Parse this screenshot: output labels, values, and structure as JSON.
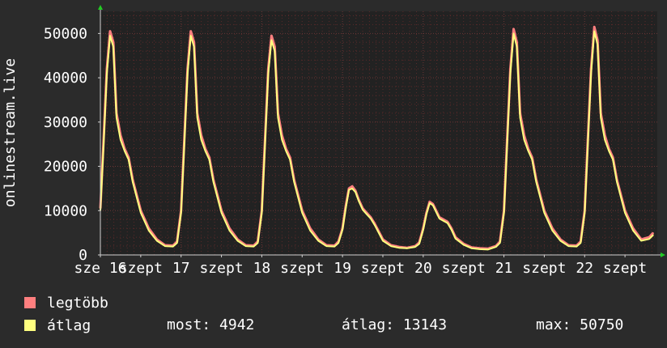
{
  "chart_data": {
    "type": "line",
    "ylabel": "onlinestream.live",
    "xlabel": "",
    "ylim": [
      0,
      55000
    ],
    "yticks": [
      0,
      10000,
      20000,
      30000,
      40000,
      50000
    ],
    "ytick_labels": [
      "0",
      "10000",
      "20000",
      "30000",
      "40000",
      "50000"
    ],
    "x_range_days": [
      16,
      23
    ],
    "x_ticks": [
      {
        "pos": 16,
        "label": "sze 16"
      },
      {
        "pos": 16.5,
        "label": "szept"
      },
      {
        "pos": 17,
        "label": "17"
      },
      {
        "pos": 17.5,
        "label": "szept"
      },
      {
        "pos": 18,
        "label": "18"
      },
      {
        "pos": 18.5,
        "label": "szept"
      },
      {
        "pos": 19,
        "label": "19"
      },
      {
        "pos": 19.5,
        "label": "szept"
      },
      {
        "pos": 20,
        "label": "20"
      },
      {
        "pos": 20.5,
        "label": "szept"
      },
      {
        "pos": 21,
        "label": "21"
      },
      {
        "pos": 21.5,
        "label": "szept"
      },
      {
        "pos": 22,
        "label": "22"
      },
      {
        "pos": 22.5,
        "label": "szept"
      }
    ],
    "grid": true,
    "colors": {
      "background": "#2b2b2b",
      "plot_bg": "#222222",
      "grid_minor": "#5a2a2a",
      "grid_major": "#6a3636",
      "max_series": "#ff7f7f",
      "avg_series": "#ffff7f",
      "axis": "#d0d0d0",
      "arrow": "#22cc22"
    },
    "series": [
      {
        "name": "legtöbb",
        "color": "#ff7f7f",
        "x": [
          16.0,
          16.04,
          16.08,
          16.12,
          16.16,
          16.2,
          16.25,
          16.3,
          16.35,
          16.4,
          16.5,
          16.6,
          16.7,
          16.8,
          16.9,
          16.95,
          17.0,
          17.04,
          17.08,
          17.12,
          17.16,
          17.2,
          17.25,
          17.3,
          17.35,
          17.4,
          17.5,
          17.6,
          17.7,
          17.8,
          17.9,
          17.95,
          18.0,
          18.04,
          18.08,
          18.12,
          18.16,
          18.2,
          18.25,
          18.3,
          18.35,
          18.4,
          18.5,
          18.6,
          18.7,
          18.8,
          18.9,
          18.95,
          19.0,
          19.04,
          19.08,
          19.12,
          19.16,
          19.2,
          19.25,
          19.3,
          19.35,
          19.4,
          19.5,
          19.6,
          19.7,
          19.8,
          19.9,
          19.95,
          20.0,
          20.04,
          20.08,
          20.12,
          20.16,
          20.2,
          20.25,
          20.3,
          20.35,
          20.4,
          20.5,
          20.6,
          20.7,
          20.8,
          20.9,
          20.95,
          21.0,
          21.04,
          21.08,
          21.12,
          21.16,
          21.2,
          21.25,
          21.3,
          21.35,
          21.4,
          21.5,
          21.6,
          21.7,
          21.8,
          21.9,
          21.95,
          22.0,
          22.04,
          22.08,
          22.12,
          22.16,
          22.2,
          22.25,
          22.3,
          22.35,
          22.4,
          22.5,
          22.6,
          22.7,
          22.8,
          22.85
        ],
        "values": [
          10500,
          26000,
          42000,
          50500,
          48000,
          32000,
          27000,
          24000,
          22000,
          17000,
          10000,
          6000,
          3500,
          2200,
          2100,
          3000,
          10000,
          26000,
          42000,
          50500,
          48000,
          32000,
          27000,
          24000,
          22000,
          17000,
          10000,
          6000,
          3500,
          2200,
          2100,
          3000,
          10000,
          26000,
          42000,
          49500,
          47000,
          32000,
          27000,
          24000,
          22000,
          17000,
          10000,
          6000,
          3500,
          2200,
          2100,
          3000,
          6000,
          11000,
          15000,
          15500,
          14500,
          12500,
          10500,
          9500,
          8500,
          7000,
          3500,
          2200,
          1800,
          1600,
          2000,
          2800,
          6000,
          9500,
          12000,
          11500,
          10000,
          8500,
          8000,
          7500,
          6000,
          4000,
          2500,
          1700,
          1500,
          1400,
          2000,
          3000,
          10000,
          26000,
          42000,
          51000,
          48000,
          32000,
          27000,
          24000,
          22000,
          17000,
          10000,
          6000,
          3500,
          2200,
          2100,
          3000,
          10000,
          26000,
          42000,
          51500,
          48500,
          32000,
          27000,
          24000,
          22000,
          17000,
          10000,
          6000,
          3500,
          4000,
          5000
        ]
      },
      {
        "name": "átlag",
        "color": "#ffff7f",
        "x": [
          16.0,
          16.04,
          16.08,
          16.12,
          16.16,
          16.2,
          16.25,
          16.3,
          16.35,
          16.4,
          16.5,
          16.6,
          16.7,
          16.8,
          16.9,
          16.95,
          17.0,
          17.04,
          17.08,
          17.12,
          17.16,
          17.2,
          17.25,
          17.3,
          17.35,
          17.4,
          17.5,
          17.6,
          17.7,
          17.8,
          17.9,
          17.95,
          18.0,
          18.04,
          18.08,
          18.12,
          18.16,
          18.2,
          18.25,
          18.3,
          18.35,
          18.4,
          18.5,
          18.6,
          18.7,
          18.8,
          18.9,
          18.95,
          19.0,
          19.04,
          19.08,
          19.12,
          19.16,
          19.2,
          19.25,
          19.3,
          19.35,
          19.4,
          19.5,
          19.6,
          19.7,
          19.8,
          19.9,
          19.95,
          20.0,
          20.04,
          20.08,
          20.12,
          20.16,
          20.2,
          20.25,
          20.3,
          20.35,
          20.4,
          20.5,
          20.6,
          20.7,
          20.8,
          20.9,
          20.95,
          21.0,
          21.04,
          21.08,
          21.12,
          21.16,
          21.2,
          21.25,
          21.3,
          21.35,
          21.4,
          21.5,
          21.6,
          21.7,
          21.8,
          21.9,
          21.95,
          22.0,
          22.04,
          22.08,
          22.12,
          22.16,
          22.2,
          22.25,
          22.3,
          22.35,
          22.4,
          22.5,
          22.6,
          22.7,
          22.8,
          22.85
        ],
        "values": [
          10000,
          25000,
          41000,
          49500,
          47000,
          31000,
          26000,
          23500,
          21500,
          16500,
          9500,
          5500,
          3200,
          2000,
          1900,
          2700,
          9500,
          25000,
          41000,
          49500,
          47000,
          31000,
          26000,
          23500,
          21500,
          16500,
          9500,
          5500,
          3200,
          2000,
          1900,
          2700,
          9500,
          25000,
          41000,
          48500,
          46000,
          31000,
          26000,
          23500,
          21500,
          16500,
          9500,
          5500,
          3200,
          2000,
          1900,
          2700,
          5700,
          10500,
          14700,
          15000,
          14200,
          12200,
          10200,
          9200,
          8200,
          6700,
          3200,
          2000,
          1600,
          1500,
          1800,
          2500,
          5700,
          9200,
          11700,
          11200,
          9700,
          8200,
          7700,
          7200,
          5700,
          3700,
          2300,
          1500,
          1300,
          1200,
          1800,
          2700,
          9500,
          25000,
          41000,
          50000,
          47000,
          31000,
          26000,
          23500,
          21500,
          16500,
          9500,
          5500,
          3200,
          2000,
          1900,
          2700,
          9500,
          25000,
          41000,
          50500,
          47500,
          31000,
          26000,
          23500,
          21500,
          16500,
          9500,
          5500,
          3200,
          3600,
          4500
        ]
      }
    ]
  },
  "legend": {
    "max_label": "legtöbb",
    "avg_label": "átlag"
  },
  "stats": {
    "now": "most: 4942",
    "avg": "átlag: 13143",
    "max": "max: 50750"
  }
}
